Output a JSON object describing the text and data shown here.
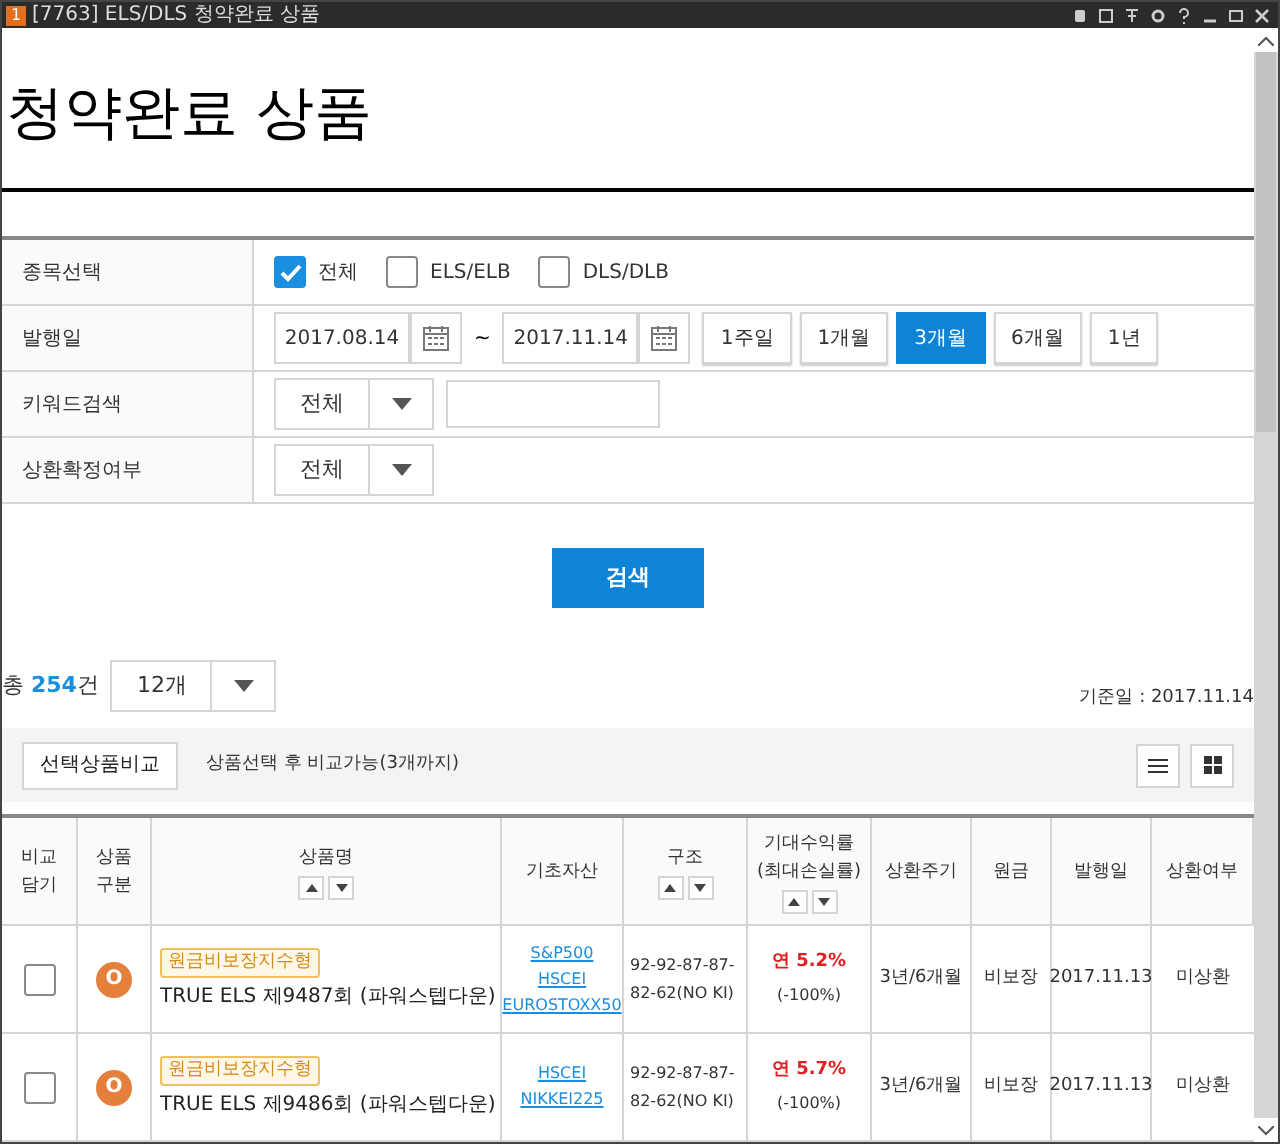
{
  "window": {
    "badge": "1",
    "title": "[7763] ELS/DLS 청약완료 상품"
  },
  "page_title": "청약완료 상품",
  "filters": {
    "product_select": {
      "label": "종목선택",
      "options": [
        {
          "label": "전체",
          "checked": true
        },
        {
          "label": "ELS/ELB",
          "checked": false
        },
        {
          "label": "DLS/DLB",
          "checked": false
        }
      ]
    },
    "issue_date": {
      "label": "발행일",
      "from": "2017.08.14",
      "separator": "~",
      "to": "2017.11.14",
      "periods": [
        {
          "label": "1주일",
          "selected": false
        },
        {
          "label": "1개월",
          "selected": false
        },
        {
          "label": "3개월",
          "selected": true
        },
        {
          "label": "6개월",
          "selected": false
        },
        {
          "label": "1년",
          "selected": false
        }
      ]
    },
    "keyword": {
      "label": "키워드검색",
      "select": "전체"
    },
    "redemption": {
      "label": "상환확정여부",
      "select": "전체"
    }
  },
  "search_button": "검색",
  "summary": {
    "prefix": "총",
    "count": "254",
    "suffix": "건",
    "page_size": "12개",
    "base_date": "기준일 : 2017.11.14"
  },
  "toolbar": {
    "compare_button": "선택상품비교",
    "hint": "상품선택 후 비교가능(3개까지)"
  },
  "table": {
    "columns": [
      {
        "label": "비교\n담기",
        "sortable": false
      },
      {
        "label": "상품\n구분",
        "sortable": false
      },
      {
        "label": "상품명",
        "sortable": true
      },
      {
        "label": "기초자산",
        "sortable": false
      },
      {
        "label": "구조",
        "sortable": true
      },
      {
        "label": "기대수익률\n(최대손실률)",
        "sortable": true
      },
      {
        "label": "상환주기",
        "sortable": false
      },
      {
        "label": "원금",
        "sortable": false
      },
      {
        "label": "발행일",
        "sortable": false
      },
      {
        "label": "상환여부",
        "sortable": false
      }
    ],
    "rows": [
      {
        "checked": false,
        "type_mark": "O",
        "tag": "원금비보장지수형",
        "name": "TRUE ELS 제9487회 (파워스텝다운)",
        "assets": [
          "S&P500",
          "HSCEI",
          "EUROSTOXX50"
        ],
        "structure": "92-92-87-87-82-62(NO KI)",
        "return": "연 5.2%",
        "max_loss": "(-100%)",
        "cycle": "3년/6개월",
        "principal": "비보장",
        "issue_date": "2017.11.13",
        "status": "미상환"
      },
      {
        "checked": false,
        "type_mark": "O",
        "tag": "원금비보장지수형",
        "name": "TRUE ELS 제9486회 (파워스텝다운)",
        "assets": [
          "HSCEI",
          "NIKKEI225"
        ],
        "structure": "92-92-87-87-82-62(NO KI)",
        "return": "연 5.7%",
        "max_loss": "(-100%)",
        "cycle": "3년/6개월",
        "principal": "비보장",
        "issue_date": "2017.11.13",
        "status": "미상환"
      }
    ]
  }
}
